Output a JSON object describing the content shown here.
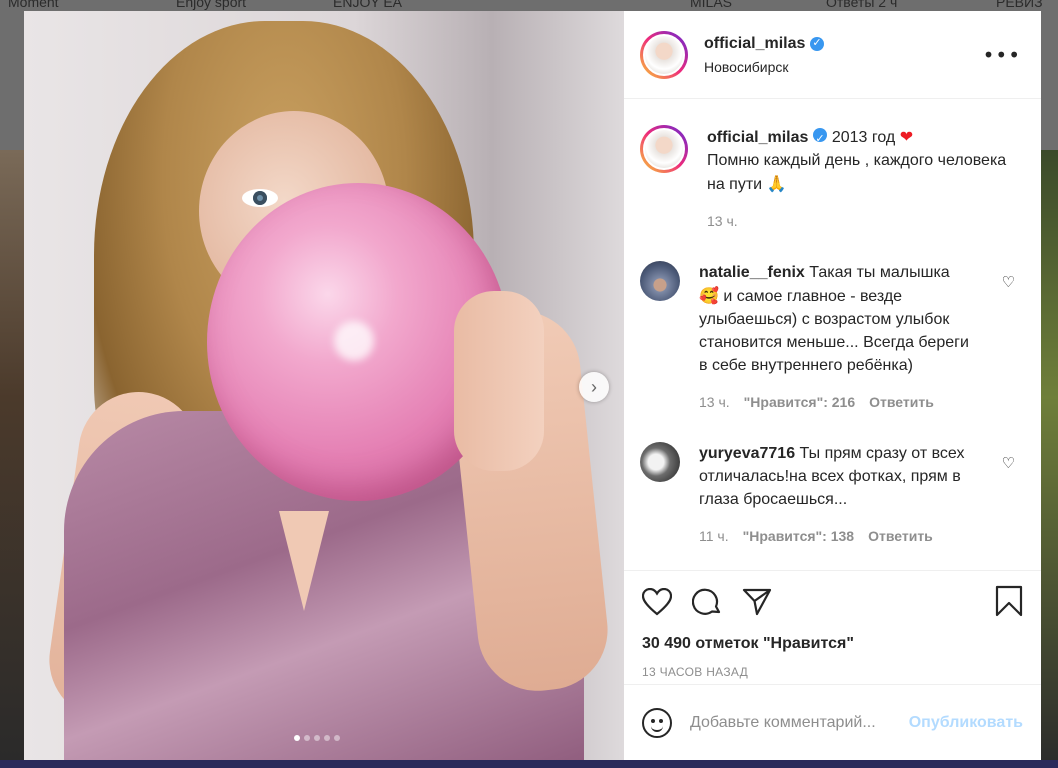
{
  "background": {
    "top_labels": [
      "Moment",
      "Enjoy sport",
      "ENJOY EA",
      "MILAS",
      "Ответы 2 ч",
      "РЕВИЗ"
    ]
  },
  "post": {
    "username": "official_milas",
    "location": "Новосибирск",
    "carousel_dots": 5,
    "active_dot": 0
  },
  "caption": {
    "username": "official_milas",
    "text_line1": "2013 год",
    "text_line2": "Помню каждый день , каждого человека на пути",
    "time": "13 ч."
  },
  "comments": [
    {
      "username": "natalie__fenix",
      "text": "Такая ты малышка",
      "text2": "и самое главное - везде улыбаешься) с возрастом улыбок становится меньше... Всегда береги в себе внутреннего ребёнка)",
      "time": "13 ч.",
      "likes": "\"Нравится\": 216",
      "reply": "Ответить"
    },
    {
      "username": "yuryeva7716",
      "text": "Ты прям сразу от всех отличалась!на всех фотках, прям в глаза бросаешься...",
      "time": "11 ч.",
      "likes": "\"Нравится\": 138",
      "reply": "Ответить"
    }
  ],
  "stats": {
    "likes": "30 490 отметок \"Нравится\"",
    "time_ago": "13 ЧАСОВ НАЗАД"
  },
  "add_comment": {
    "placeholder": "Добавьте комментарий...",
    "publish": "Опубликовать"
  },
  "colors": {
    "verified": "#3897f0",
    "publish_disabled": "#b3dbff",
    "heart_emoji": "#ed1c24"
  }
}
